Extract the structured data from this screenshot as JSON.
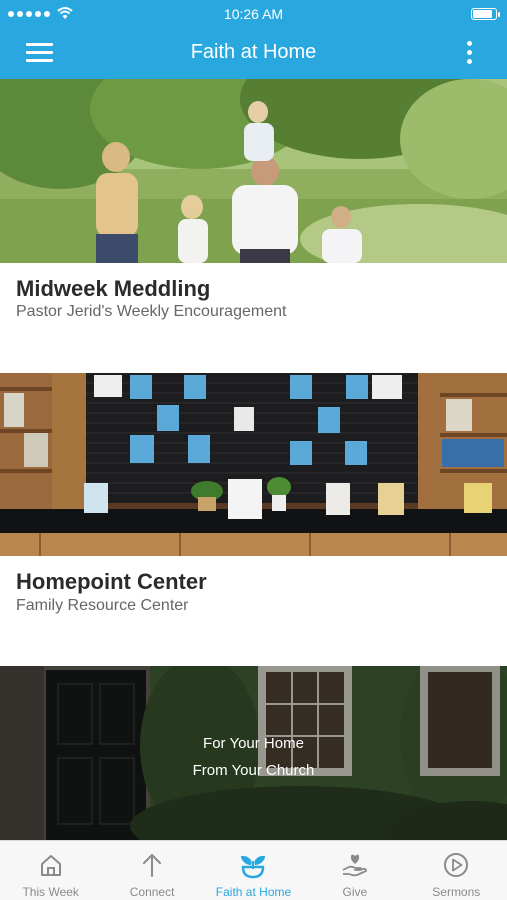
{
  "status_bar": {
    "time": "10:26 AM",
    "battery_level": 0.9
  },
  "nav": {
    "title": "Faith at Home",
    "menu_icon": "hamburger-menu-icon",
    "more_icon": "more-vertical-icon"
  },
  "cards": [
    {
      "title": "Midweek Meddling",
      "subtitle": "Pastor Jerid's Weekly Encouragement",
      "image": "family-walking-photo"
    },
    {
      "title": "Homepoint Center",
      "subtitle": "Family Resource Center",
      "image": "resource-wall-photo"
    },
    {
      "overlay_line1": "For Your Home",
      "overlay_line2": "From Your Church",
      "image": "house-front-photo"
    }
  ],
  "tabs": [
    {
      "label": "This Week",
      "icon": "house-icon",
      "active": false
    },
    {
      "label": "Connect",
      "icon": "arrow-up-icon",
      "active": false
    },
    {
      "label": "Faith at Home",
      "icon": "sprout-icon",
      "active": true
    },
    {
      "label": "Give",
      "icon": "giving-hand-icon",
      "active": false
    },
    {
      "label": "Sermons",
      "icon": "play-circle-icon",
      "active": false
    }
  ],
  "colors": {
    "accent": "#29a8e0",
    "tab_inactive": "#8a8a8a",
    "title_text": "#2b2b2b",
    "subtitle_text": "#666666"
  }
}
